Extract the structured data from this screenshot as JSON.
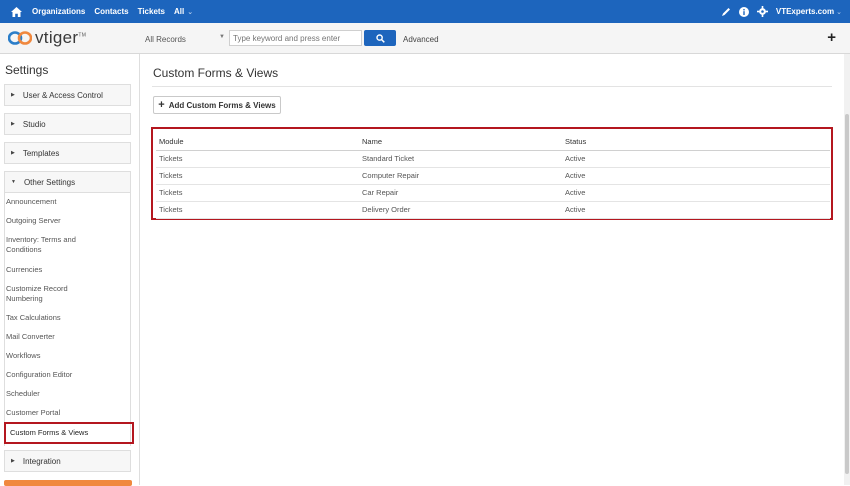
{
  "topnav": {
    "items": [
      "Organizations",
      "Contacts",
      "Tickets",
      "All"
    ],
    "user": "VTExperts.com"
  },
  "header": {
    "logo_text": "vtiger",
    "logo_tm": "TM",
    "filter_value": "All Records",
    "search_placeholder": "Type keyword and press enter",
    "advanced_label": "Advanced",
    "add_symbol": "+"
  },
  "sidebar": {
    "title": "Settings",
    "sections": [
      "User & Access Control",
      "Studio",
      "Templates",
      "Other Settings",
      "Integration"
    ],
    "other_settings_items": [
      [
        "Announcement"
      ],
      [
        "Outgoing Server"
      ],
      [
        "Inventory: Terms and",
        "Conditions"
      ],
      [
        "Currencies"
      ],
      [
        "Customize Record",
        "Numbering"
      ],
      [
        "Tax Calculations"
      ],
      [
        "Mail Converter"
      ],
      [
        "Workflows"
      ],
      [
        "Configuration Editor"
      ],
      [
        "Scheduler"
      ],
      [
        "Customer Portal"
      ],
      [
        "Custom Forms & Views"
      ]
    ]
  },
  "main": {
    "title": "Custom Forms & Views",
    "add_button": "Add Custom Forms & Views",
    "table": {
      "headers": [
        "Module",
        "Name",
        "Status"
      ],
      "rows": [
        [
          "Tickets",
          "Standard Ticket",
          "Active"
        ],
        [
          "Tickets",
          "Computer Repair",
          "Active"
        ],
        [
          "Tickets",
          "Car Repair",
          "Active"
        ],
        [
          "Tickets",
          "Delivery Order",
          "Active"
        ]
      ]
    }
  },
  "colors": {
    "nav_blue": "#1d65bd",
    "highlight_red": "#b4171f",
    "accent_orange": "#f0883e"
  }
}
